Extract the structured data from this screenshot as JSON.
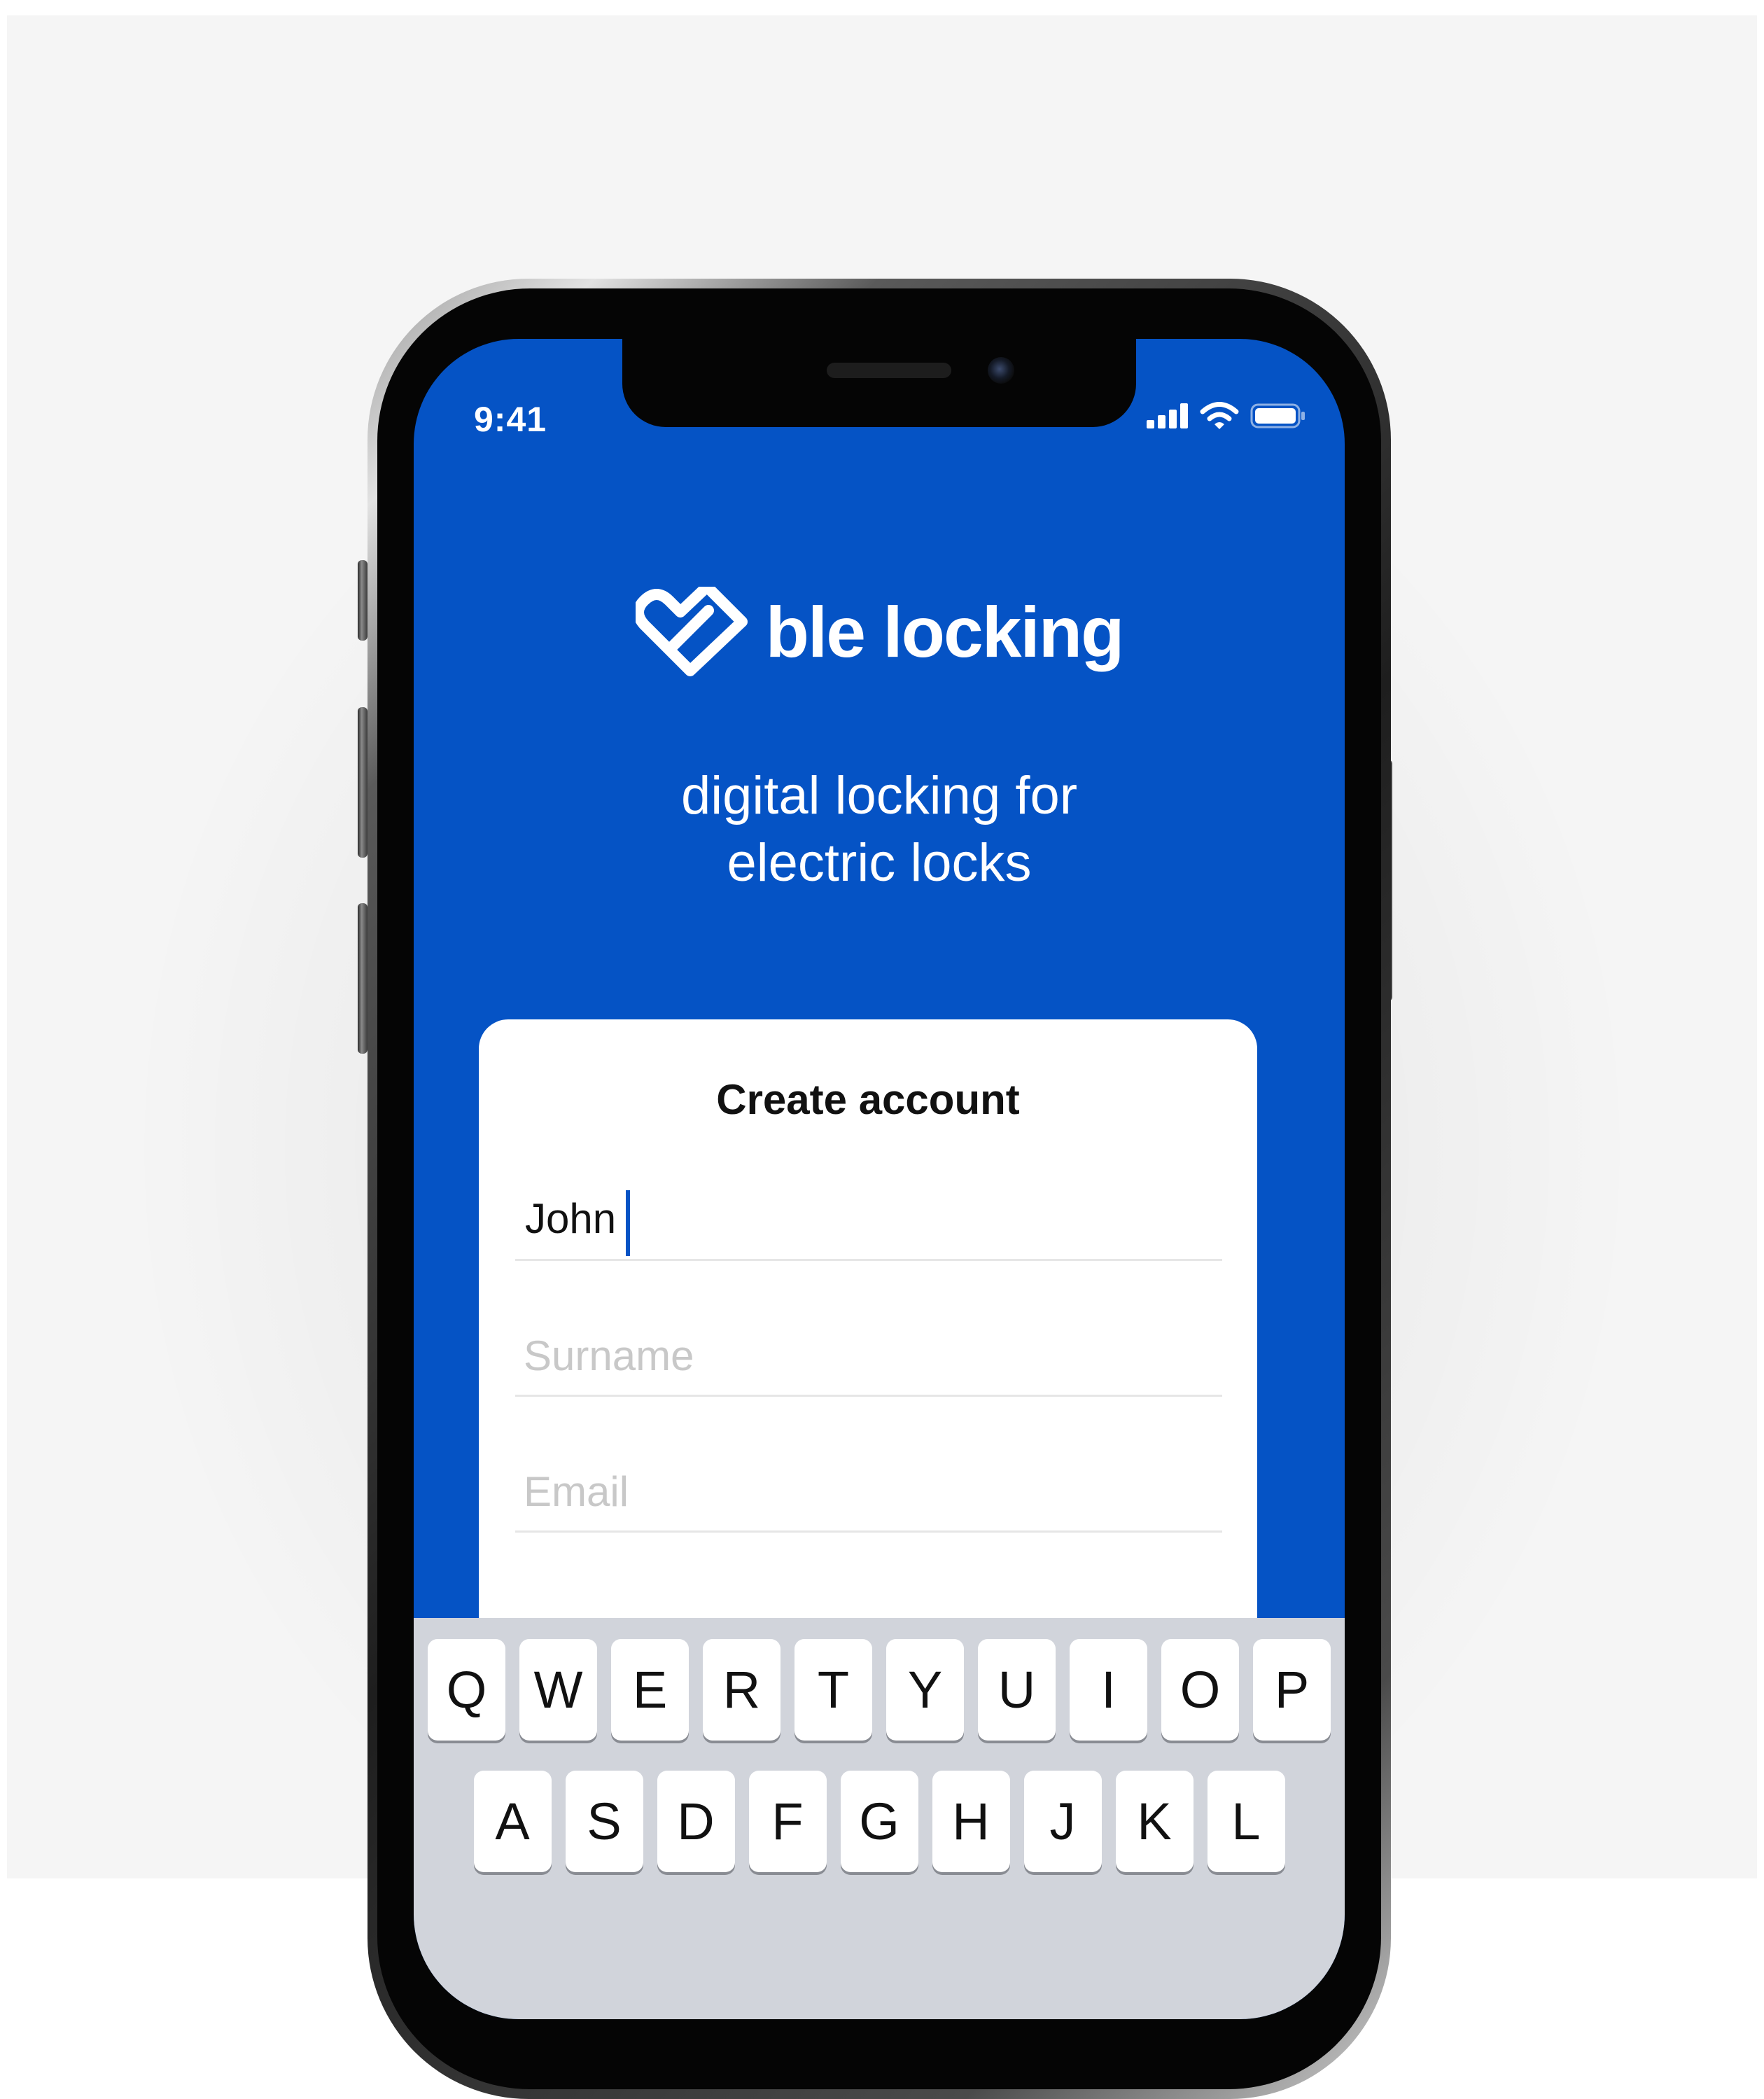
{
  "status_bar": {
    "time": "9:41",
    "signal_icon": "cellular-signal-icon",
    "wifi_icon": "wifi-icon",
    "battery_icon": "battery-icon"
  },
  "brand": {
    "logo_icon": "heart-check-logo-icon",
    "name": "ble locking",
    "color": "#0553c5"
  },
  "tagline": {
    "line1": "digital locking for",
    "line2": "electric locks"
  },
  "form": {
    "title": "Create account",
    "first_name_value": "John",
    "surname_placeholder": "Surname",
    "email_placeholder": "Email"
  },
  "keyboard": {
    "row1": [
      "Q",
      "W",
      "E",
      "R",
      "T",
      "Y",
      "U",
      "I",
      "O",
      "P"
    ],
    "row2": [
      "A",
      "S",
      "D",
      "F",
      "G",
      "H",
      "J",
      "K",
      "L"
    ]
  }
}
